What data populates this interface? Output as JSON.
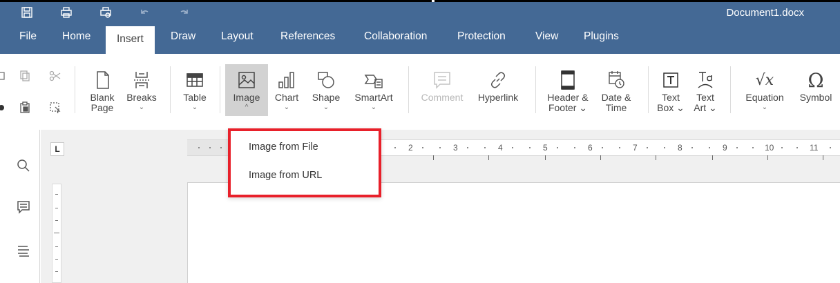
{
  "title_bar": {
    "document_name": "Document1.docx",
    "quick_access": [
      "save-icon",
      "print-icon",
      "quick-print-icon",
      "undo-icon",
      "redo-icon"
    ]
  },
  "menu": {
    "tabs": [
      {
        "label": "File"
      },
      {
        "label": "Home"
      },
      {
        "label": "Insert",
        "active": true
      },
      {
        "label": "Draw"
      },
      {
        "label": "Layout"
      },
      {
        "label": "References"
      },
      {
        "label": "Collaboration"
      },
      {
        "label": "Protection"
      },
      {
        "label": "View"
      },
      {
        "label": "Plugins"
      }
    ]
  },
  "ribbon": {
    "blank_page": {
      "line1": "Blank",
      "line2": "Page"
    },
    "breaks": {
      "label": "Breaks",
      "chevron": "⌄"
    },
    "table": {
      "label": "Table",
      "chevron": "⌄"
    },
    "image": {
      "label": "Image",
      "chevron": "^"
    },
    "chart": {
      "label": "Chart",
      "chevron": "⌄"
    },
    "shape": {
      "label": "Shape",
      "chevron": "⌄"
    },
    "smartart": {
      "label": "SmartArt",
      "chevron": "⌄"
    },
    "comment": {
      "label": "Comment"
    },
    "hyperlink": {
      "label": "Hyperlink"
    },
    "header_footer": {
      "line1": "Header &",
      "line2": "Footer ⌄"
    },
    "date_time": {
      "line1": "Date &",
      "line2": "Time"
    },
    "text_box": {
      "line1": "Text",
      "line2": "Box ⌄"
    },
    "text_art": {
      "line1": "Text",
      "line2": "Art ⌄"
    },
    "equation": {
      "label": "Equation",
      "chevron": "⌄"
    },
    "symbol": {
      "label": "Symbol"
    }
  },
  "image_menu": {
    "items": [
      {
        "label": "Image from File"
      },
      {
        "label": "Image from URL"
      }
    ]
  },
  "ruler": {
    "corner": "L",
    "labels": [
      "2",
      "3",
      "4",
      "5",
      "6",
      "7",
      "8",
      "9",
      "10",
      "11"
    ]
  },
  "colors": {
    "header_bg": "#446995",
    "highlight_border": "#e8202a",
    "pressed_bg": "#d2d2d2"
  }
}
